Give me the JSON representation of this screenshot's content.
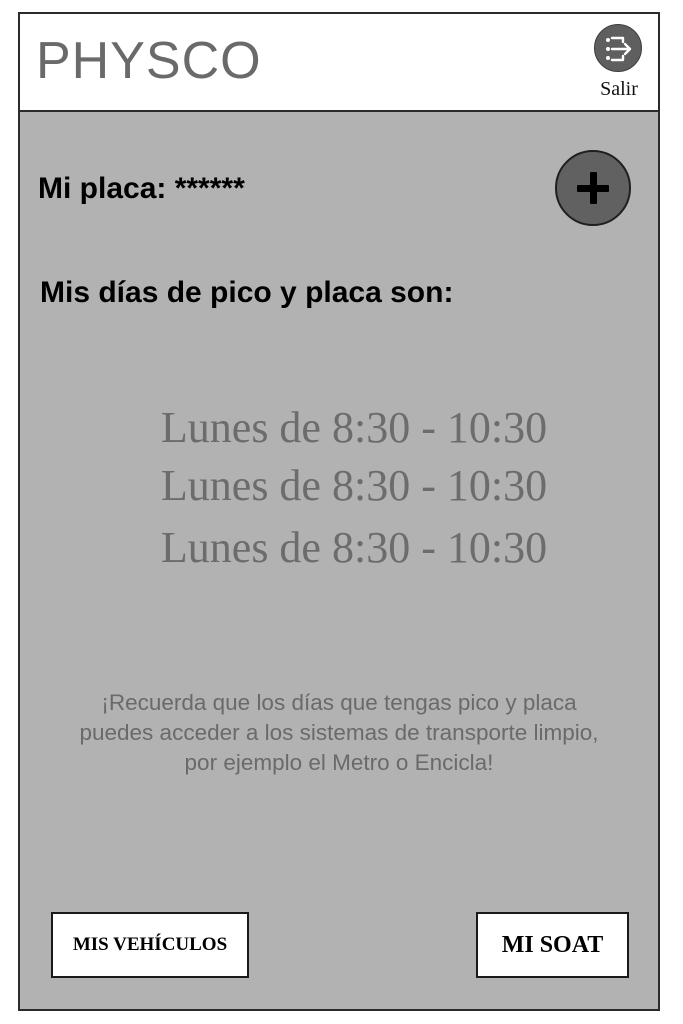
{
  "header": {
    "app_title": "PHYSCO",
    "logout_label": "Salir",
    "logout_icon": "logout-icon"
  },
  "main": {
    "plate_text": "Mi placa: ******",
    "add_icon": "plus-icon",
    "days_heading": "Mis días de pico y placa son:",
    "schedule": [
      "Lunes de 8:30 - 10:30",
      "Lunes de 8:30 - 10:30",
      "Lunes de 8:30 - 10:30"
    ],
    "reminder_lines": [
      "¡Recuerda que los días que tengas pico y placa",
      "puedes acceder a los sistemas de transporte limpio,",
      "por ejemplo el Metro o Encicla!"
    ]
  },
  "footer": {
    "vehicles_button": "MIS VEHÍCULOS",
    "soat_button": "MI SOAT"
  },
  "colors": {
    "content_background": "#b2b2b2",
    "title_gray": "#6a6a6a",
    "icon_fill": "#616161"
  }
}
